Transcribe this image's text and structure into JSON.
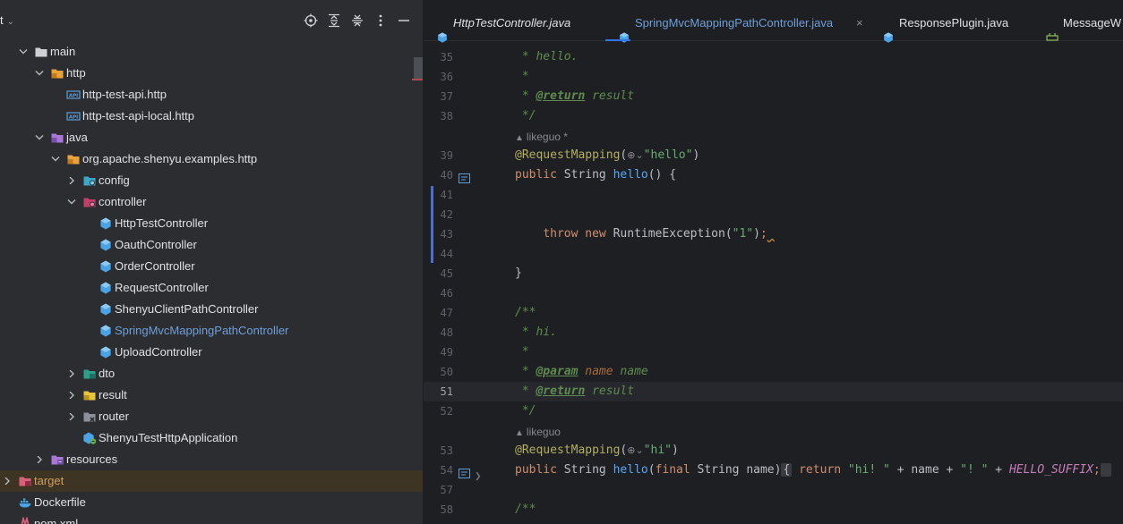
{
  "project": {
    "title": "t",
    "tree": [
      {
        "label": "main",
        "indent": 2,
        "arrow": "down",
        "icon": "folder-icon"
      },
      {
        "label": "http",
        "indent": 3,
        "arrow": "down",
        "icon": "resource-folder-icon"
      },
      {
        "label": "http-test-api.http",
        "indent": 4,
        "arrow": "none",
        "icon": "api-file-icon"
      },
      {
        "label": "http-test-api-local.http",
        "indent": 4,
        "arrow": "none",
        "icon": "api-file-icon"
      },
      {
        "label": "java",
        "indent": 3,
        "arrow": "down",
        "icon": "source-folder-icon"
      },
      {
        "label": "org.apache.shenyu.examples.http",
        "indent": 4,
        "arrow": "down",
        "icon": "package-icon"
      },
      {
        "label": "config",
        "indent": 5,
        "arrow": "right",
        "icon": "config-package-icon"
      },
      {
        "label": "controller",
        "indent": 5,
        "arrow": "down",
        "icon": "controller-package-icon"
      },
      {
        "label": "HttpTestController",
        "indent": 6,
        "arrow": "none",
        "icon": "java-class-icon"
      },
      {
        "label": "OauthController",
        "indent": 6,
        "arrow": "none",
        "icon": "java-class-icon"
      },
      {
        "label": "OrderController",
        "indent": 6,
        "arrow": "none",
        "icon": "java-class-icon"
      },
      {
        "label": "RequestController",
        "indent": 6,
        "arrow": "none",
        "icon": "java-class-icon"
      },
      {
        "label": "ShenyuClientPathController",
        "indent": 6,
        "arrow": "none",
        "icon": "java-class-icon"
      },
      {
        "label": "SpringMvcMappingPathController",
        "indent": 6,
        "arrow": "none",
        "icon": "java-class-icon",
        "style": "selected-file"
      },
      {
        "label": "UploadController",
        "indent": 6,
        "arrow": "none",
        "icon": "java-class-icon"
      },
      {
        "label": "dto",
        "indent": 5,
        "arrow": "right",
        "icon": "dto-package-icon"
      },
      {
        "label": "result",
        "indent": 5,
        "arrow": "right",
        "icon": "result-package-icon"
      },
      {
        "label": "router",
        "indent": 5,
        "arrow": "right",
        "icon": "router-package-icon"
      },
      {
        "label": "ShenyuTestHttpApplication",
        "indent": 5,
        "arrow": "none",
        "icon": "spring-app-icon"
      },
      {
        "label": "resources",
        "indent": 3,
        "arrow": "right",
        "icon": "resources-folder-icon"
      },
      {
        "label": "target",
        "indent": 1,
        "arrow": "right",
        "icon": "excluded-folder-icon",
        "style": "excluded"
      },
      {
        "label": "Dockerfile",
        "indent": 1,
        "arrow": "none",
        "icon": "docker-icon"
      },
      {
        "label": "pom.xml",
        "indent": 1,
        "arrow": "none",
        "icon": "maven-icon"
      }
    ]
  },
  "editor": {
    "tabs": [
      {
        "label": "HttpTestController.java",
        "active": false,
        "italic": true,
        "closable": false,
        "icon": "java-class-icon"
      },
      {
        "label": "SpringMvcMappingPathController.java",
        "active": true,
        "italic": false,
        "closable": true,
        "icon": "java-class-icon"
      },
      {
        "label": "ResponsePlugin.java",
        "active": false,
        "italic": false,
        "closable": false,
        "icon": "java-class-icon"
      },
      {
        "label": "MessageW",
        "active": false,
        "italic": false,
        "closable": false,
        "icon": "plugin-icon"
      }
    ],
    "close_glyph": "×",
    "current_line": "51",
    "lines": [
      {
        "n": "35",
        "parts": [
          [
            "cm",
            " * hello."
          ]
        ]
      },
      {
        "n": "36",
        "parts": [
          [
            "cm",
            " *"
          ]
        ]
      },
      {
        "n": "37",
        "parts": [
          [
            "cm",
            " * "
          ],
          [
            "tag",
            "@return"
          ],
          [
            "cm",
            " result"
          ]
        ]
      },
      {
        "n": "38",
        "parts": [
          [
            "cm",
            " */"
          ]
        ]
      },
      {
        "hint": "likeguo *"
      },
      {
        "n": "39",
        "parts": [
          [
            "an",
            "@RequestMapping"
          ],
          [
            "",
            "("
          ],
          [
            "globe",
            "⊕⌄"
          ],
          [
            "str",
            "\"hello\""
          ],
          [
            "",
            ")"
          ]
        ]
      },
      {
        "n": "40",
        "gutter": true,
        "parts": [
          [
            "kw",
            "public "
          ],
          [
            "",
            "String "
          ],
          [
            "fn",
            "hello"
          ],
          [
            "",
            "() {"
          ]
        ]
      },
      {
        "n": "41",
        "parts": []
      },
      {
        "n": "42",
        "parts": []
      },
      {
        "n": "43",
        "parts": [
          [
            "",
            "    "
          ],
          [
            "kw",
            "throw new "
          ],
          [
            "",
            "RuntimeException("
          ],
          [
            "str",
            "\"1\""
          ],
          [
            "",
            ")"
          ],
          [
            "kw",
            ";"
          ],
          [
            "warn",
            " "
          ]
        ]
      },
      {
        "n": "44",
        "parts": []
      },
      {
        "n": "45",
        "parts": [
          [
            "",
            "}"
          ]
        ]
      },
      {
        "n": "46",
        "parts": []
      },
      {
        "n": "47",
        "parts": [
          [
            "cm",
            "/**"
          ]
        ]
      },
      {
        "n": "48",
        "parts": [
          [
            "cm",
            " * hi."
          ]
        ]
      },
      {
        "n": "49",
        "parts": [
          [
            "cm",
            " *"
          ]
        ]
      },
      {
        "n": "50",
        "parts": [
          [
            "cm",
            " * "
          ],
          [
            "tag",
            "@param"
          ],
          [
            "pn",
            " name"
          ],
          [
            "cm",
            " name"
          ]
        ]
      },
      {
        "n": "51",
        "parts": [
          [
            "cm",
            " * "
          ],
          [
            "tag",
            "@return"
          ],
          [
            "cm",
            " result"
          ]
        ]
      },
      {
        "n": "52",
        "parts": [
          [
            "cm",
            " */"
          ]
        ]
      },
      {
        "hint": "likeguo"
      },
      {
        "n": "53",
        "parts": [
          [
            "an",
            "@RequestMapping"
          ],
          [
            "",
            "("
          ],
          [
            "globe",
            "⊕⌄"
          ],
          [
            "str",
            "\"hi\""
          ],
          [
            "",
            ")"
          ]
        ]
      },
      {
        "n": "54",
        "gutter": true,
        "fold": true,
        "parts": [
          [
            "kw",
            "public "
          ],
          [
            "",
            "String "
          ],
          [
            "fn",
            "hello"
          ],
          [
            "",
            "("
          ],
          [
            "kw",
            "final "
          ],
          [
            "",
            "String name)"
          ],
          [
            "box",
            "{"
          ],
          [
            "kw",
            " return "
          ],
          [
            "str",
            "\"hi! \""
          ],
          [
            "",
            " + name + "
          ],
          [
            "str",
            "\"! \""
          ],
          [
            "",
            " + "
          ],
          [
            "cst",
            "HELLO_SUFFIX"
          ],
          [
            "kw",
            ";"
          ],
          [
            "box",
            " "
          ]
        ]
      },
      {
        "n": "57",
        "parts": []
      },
      {
        "n": "58",
        "parts": [
          [
            "cm",
            "/**"
          ]
        ]
      }
    ]
  },
  "colors": {
    "accent": "#3574f0",
    "selected_file": "#6f9fd8",
    "excluded": "#d1a15f"
  }
}
